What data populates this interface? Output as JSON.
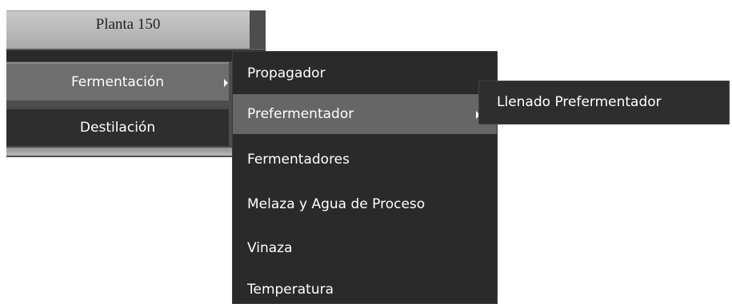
{
  "menu": {
    "plant_title": "Planta 150",
    "items": [
      {
        "label": "Fermentación"
      },
      {
        "label": "Destilación"
      }
    ]
  },
  "submenu_fermentacion": {
    "items": [
      {
        "label": "Propagador"
      },
      {
        "label": "Prefermentador"
      },
      {
        "label": "Fermentadores"
      },
      {
        "label": "Melaza y Agua de Proceso"
      },
      {
        "label": "Vinaza"
      },
      {
        "label": "Temperatura"
      }
    ]
  },
  "submenu_prefermentador": {
    "items": [
      {
        "label": "Llenado Prefermentador"
      }
    ]
  },
  "colors": {
    "menu_dark": "#2a2a2a",
    "menu_active": "#666666",
    "header_gray": "#b8b8b8",
    "text": "#ffffff"
  }
}
